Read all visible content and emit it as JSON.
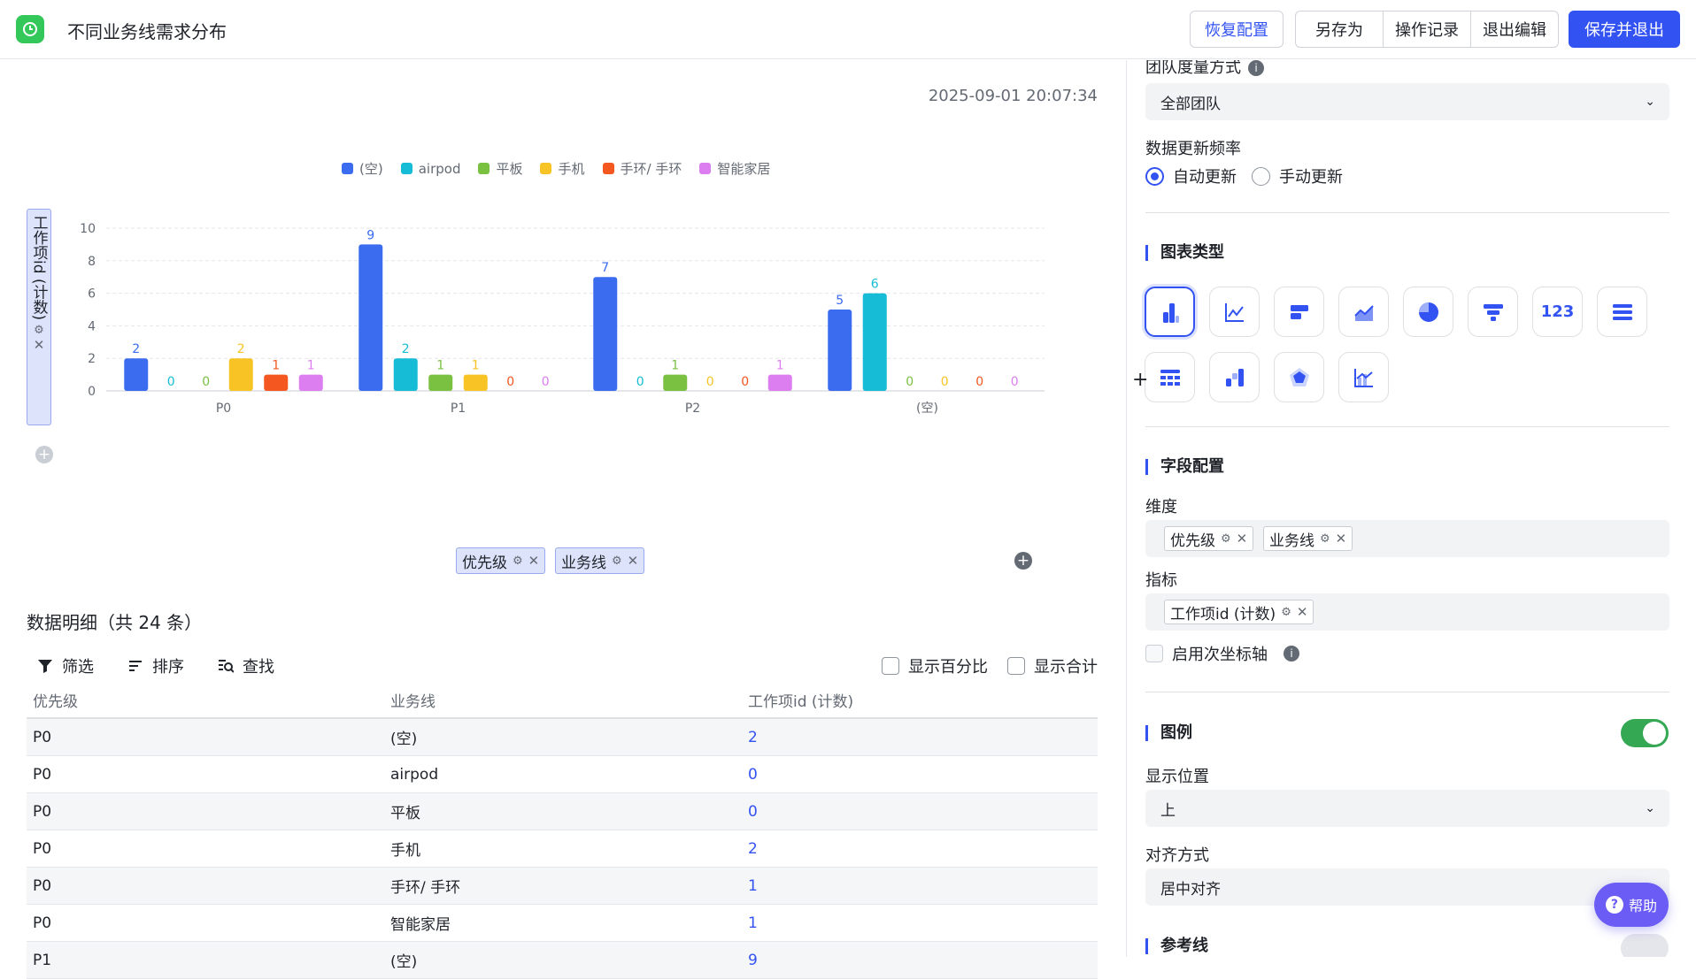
{
  "header": {
    "title": "不同业务线需求分布",
    "buttons": {
      "restore": "恢复配置",
      "save_as": "另存为",
      "history": "操作记录",
      "exit_edit": "退出编辑",
      "save_exit": "保存并退出"
    }
  },
  "chart_panel": {
    "timestamp": "2025-09-01 20:07:34",
    "y_field": "工作项id (计数)",
    "x_fields": [
      "优先级",
      "业务线"
    ]
  },
  "chart_data": {
    "type": "bar",
    "categories": [
      "P0",
      "P1",
      "P2",
      "(空)"
    ],
    "ylim": [
      0,
      10
    ],
    "yticks": [
      0,
      2,
      4,
      6,
      8,
      10
    ],
    "legend_position": "top",
    "grid": true,
    "series": [
      {
        "name": "(空)",
        "color": "#3b6cf0",
        "values": [
          2,
          9,
          7,
          5
        ]
      },
      {
        "name": "airpod",
        "color": "#16bcd6",
        "values": [
          0,
          2,
          0,
          6
        ]
      },
      {
        "name": "平板",
        "color": "#7ac142",
        "values": [
          0,
          1,
          1,
          0
        ]
      },
      {
        "name": "手机",
        "color": "#f7c325",
        "values": [
          2,
          1,
          0,
          0
        ]
      },
      {
        "name": "手环/ 手环",
        "color": "#f4571f",
        "values": [
          1,
          0,
          0,
          0
        ]
      },
      {
        "name": "智能家居",
        "color": "#dc7df0",
        "values": [
          1,
          0,
          1,
          0
        ]
      }
    ]
  },
  "detail": {
    "title": "数据明细（共 24 条）",
    "tools": {
      "filter": "筛选",
      "sort": "排序",
      "find": "查找"
    },
    "toggles": {
      "percent": "显示百分比",
      "total": "显示合计"
    },
    "columns": [
      "优先级",
      "业务线",
      "工作项id (计数)"
    ],
    "rows": [
      [
        "P0",
        "(空)",
        "2"
      ],
      [
        "P0",
        "airpod",
        "0"
      ],
      [
        "P0",
        "平板",
        "0"
      ],
      [
        "P0",
        "手机",
        "2"
      ],
      [
        "P0",
        "手环/ 手环",
        "1"
      ],
      [
        "P0",
        "智能家居",
        "1"
      ],
      [
        "P1",
        "(空)",
        "9"
      ]
    ]
  },
  "settings": {
    "team_metric_label": "团队度量方式",
    "team_metric_value": "全部团队",
    "refresh_label": "数据更新频率",
    "refresh_auto": "自动更新",
    "refresh_manual": "手动更新",
    "chart_type_label": "图表类型",
    "field_config_label": "字段配置",
    "dimension_label": "维度",
    "dimensions": [
      "优先级",
      "业务线"
    ],
    "metric_label": "指标",
    "metrics": [
      "工作项id (计数)"
    ],
    "secondary_axis": "启用次坐标轴",
    "legend_label": "图例",
    "legend_position_label": "显示位置",
    "legend_position_value": "上",
    "align_label": "对齐方式",
    "align_value": "居中对齐",
    "refline_label": "参考线",
    "number_icon_text": "123"
  },
  "help": "帮助"
}
